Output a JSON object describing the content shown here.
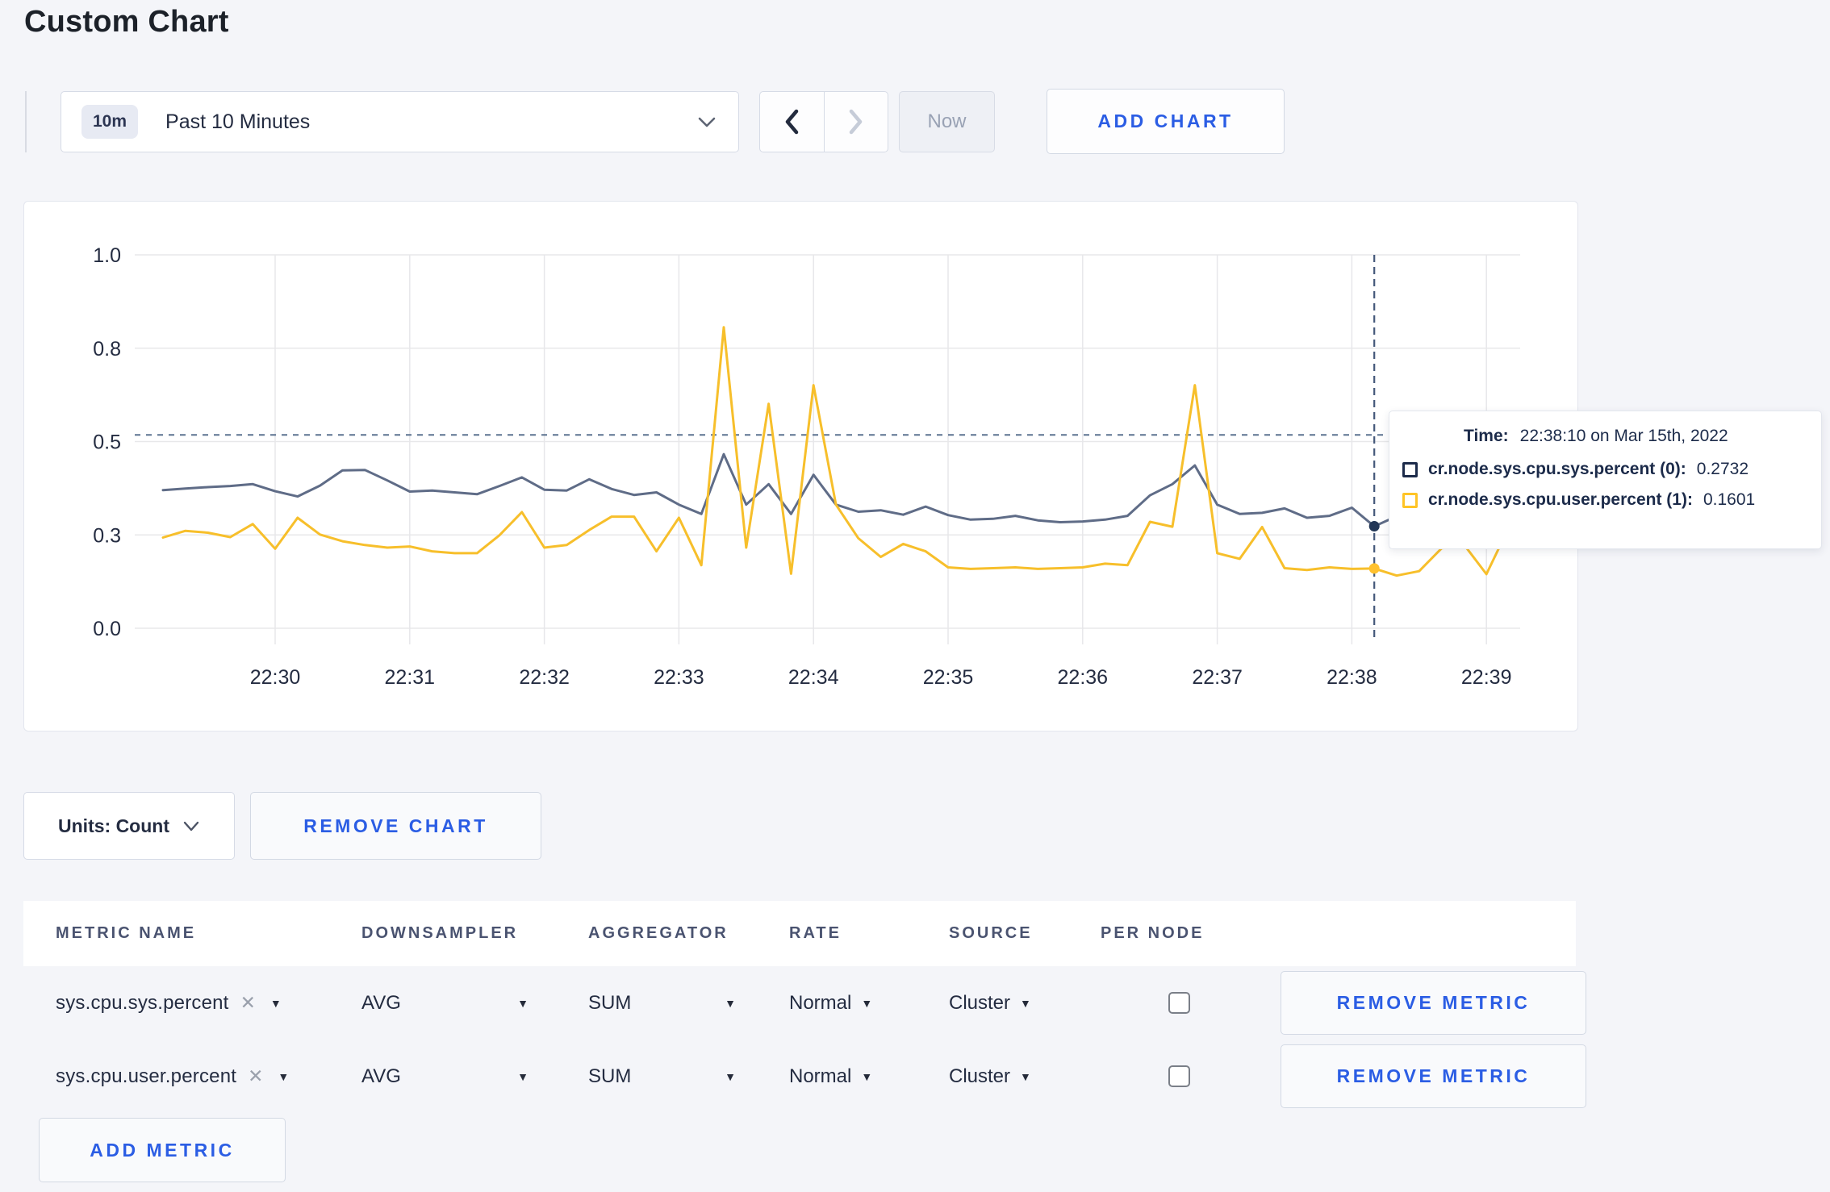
{
  "page": {
    "title": "Custom Chart",
    "background_color": "#f4f5f9",
    "accent_color": "#2b5de4"
  },
  "toolbar": {
    "time_badge": "10m",
    "time_label": "Past 10 Minutes",
    "now_label": "Now",
    "add_chart_label": "ADD CHART"
  },
  "chart": {
    "crosshair": {
      "x_offset_sec": 490,
      "hline_value": 0.518,
      "dots": [
        {
          "value": 0.2732,
          "color": "#233757"
        },
        {
          "value": 0.1601,
          "color": "#ffc12e"
        }
      ]
    },
    "tooltip": {
      "time_label": "Time:",
      "time_value": "22:38:10 on Mar 15th, 2022",
      "rows": [
        {
          "name": "cr.node.sys.cpu.sys.percent (0):",
          "value": "0.2732",
          "color": "#1c2b4a"
        },
        {
          "name": "cr.node.sys.cpu.user.percent (1):",
          "value": "0.1601",
          "color": "#ffc426"
        }
      ]
    }
  },
  "chart_data": {
    "type": "line",
    "title": "",
    "xlabel": "",
    "ylabel": "",
    "grid": true,
    "legend": false,
    "x_axis": {
      "ticks": [
        "22:30",
        "22:31",
        "22:32",
        "22:33",
        "22:34",
        "22:35",
        "22:36",
        "22:37",
        "22:38",
        "22:39"
      ],
      "start_time": "22:29:10",
      "start_offset_sec": -50,
      "interval_seconds": 10
    },
    "y_axis": {
      "range": [
        0,
        1
      ],
      "ticks": [
        {
          "value": 0.0,
          "label": "0.0"
        },
        {
          "value": 0.25,
          "label": "0.3"
        },
        {
          "value": 0.5,
          "label": "0.5"
        },
        {
          "value": 0.75,
          "label": "0.8"
        },
        {
          "value": 1.0,
          "label": "1.0"
        }
      ]
    },
    "series": [
      {
        "id": "sys",
        "name": "cr.node.sys.cpu.sys.percent",
        "color": "#5f6c87",
        "values": [
          0.37,
          0.374,
          0.378,
          0.381,
          0.386,
          0.367,
          0.353,
          0.382,
          0.423,
          0.424,
          0.396,
          0.366,
          0.369,
          0.364,
          0.359,
          0.381,
          0.404,
          0.371,
          0.369,
          0.399,
          0.373,
          0.357,
          0.364,
          0.331,
          0.306,
          0.466,
          0.331,
          0.386,
          0.306,
          0.411,
          0.331,
          0.312,
          0.316,
          0.304,
          0.326,
          0.303,
          0.291,
          0.293,
          0.301,
          0.289,
          0.284,
          0.286,
          0.291,
          0.301,
          0.356,
          0.386,
          0.436,
          0.331,
          0.306,
          0.309,
          0.321,
          0.296,
          0.301,
          0.323,
          0.273,
          0.3,
          0.296,
          0.301,
          0.306,
          0.301,
          0.304
        ]
      },
      {
        "id": "user",
        "name": "cr.node.sys.cpu.user.percent",
        "color": "#f7bf2b",
        "values": [
          0.243,
          0.261,
          0.256,
          0.244,
          0.279,
          0.213,
          0.296,
          0.251,
          0.233,
          0.223,
          0.216,
          0.219,
          0.206,
          0.201,
          0.201,
          0.249,
          0.311,
          0.216,
          0.223,
          0.263,
          0.299,
          0.299,
          0.206,
          0.296,
          0.169,
          0.806,
          0.216,
          0.601,
          0.146,
          0.651,
          0.331,
          0.241,
          0.191,
          0.226,
          0.206,
          0.163,
          0.159,
          0.161,
          0.163,
          0.159,
          0.161,
          0.163,
          0.173,
          0.169,
          0.285,
          0.272,
          0.651,
          0.201,
          0.186,
          0.271,
          0.161,
          0.156,
          0.163,
          0.159,
          0.16,
          0.141,
          0.153,
          0.214,
          0.224,
          0.145,
          0.27
        ]
      }
    ]
  },
  "chart_controls": {
    "units_label": "Units: Count",
    "remove_chart_label": "REMOVE CHART"
  },
  "metrics_table": {
    "headers": [
      "METRIC NAME",
      "DOWNSAMPLER",
      "AGGREGATOR",
      "RATE",
      "SOURCE",
      "PER NODE"
    ],
    "rows": [
      {
        "metric": "sys.cpu.sys.percent",
        "downsampler": "AVG",
        "aggregator": "SUM",
        "rate": "Normal",
        "source": "Cluster",
        "per_node_checked": false,
        "remove_label": "REMOVE METRIC"
      },
      {
        "metric": "sys.cpu.user.percent",
        "downsampler": "AVG",
        "aggregator": "SUM",
        "rate": "Normal",
        "source": "Cluster",
        "per_node_checked": false,
        "remove_label": "REMOVE METRIC"
      }
    ],
    "add_metric_label": "ADD METRIC"
  }
}
